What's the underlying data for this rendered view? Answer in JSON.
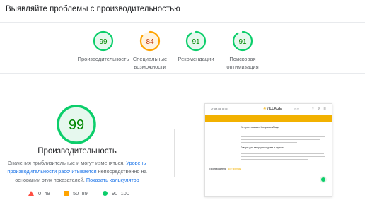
{
  "header": {
    "title": "Выявляйте проблемы с производительностью"
  },
  "colors": {
    "pass": "#0cce6b",
    "average": "#ffa400",
    "fail": "#ff4e42",
    "link": "#1a73e8"
  },
  "categories": [
    {
      "score": 99,
      "label": "Производительность",
      "status": "pass"
    },
    {
      "score": 84,
      "label": "Специальные возможности",
      "status": "average"
    },
    {
      "score": 91,
      "label": "Рекомендации",
      "status": "pass"
    },
    {
      "score": 91,
      "label": "Поисковая оптимизация",
      "status": "pass"
    }
  ],
  "performance": {
    "score": 99,
    "title": "Производительность",
    "desc_before": "Значения приблизительные и могут изменяться.",
    "link_text": "Уровень производительности рассчитывается",
    "desc_after": "непосредственно на основании этих показателей.",
    "calculator_link": "Показать калькулятор"
  },
  "legend": [
    {
      "range": "0–49",
      "shape": "triangle"
    },
    {
      "range": "50–89",
      "shape": "square"
    },
    {
      "range": "90–100",
      "shape": "circle"
    }
  ],
  "screenshot": {
    "phone": "+7 495 000 00 00",
    "logo": "VILLAGE",
    "heading": "Интернет-магазин Конджика Village",
    "subheading": "Товары для загородного дома и отдыха",
    "caption": "Производители",
    "caption_link": "Все бренды"
  }
}
